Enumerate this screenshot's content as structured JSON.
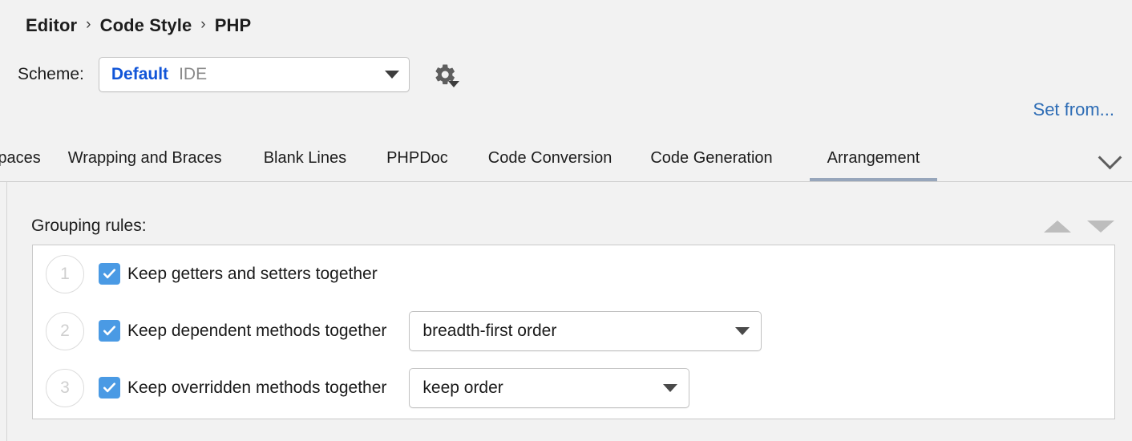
{
  "breadcrumb": {
    "separator": "›",
    "items": [
      "Editor",
      "Code Style",
      "PHP"
    ]
  },
  "scheme": {
    "label": "Scheme:",
    "name": "Default",
    "scope": "IDE",
    "dropdown_icon": "caret-down-icon",
    "gear_icon": "gear-icon"
  },
  "links": {
    "set_from": "Set from..."
  },
  "tabs": {
    "items": [
      {
        "label": "Spaces",
        "active": false
      },
      {
        "label": "Wrapping and Braces",
        "active": false
      },
      {
        "label": "Blank Lines",
        "active": false
      },
      {
        "label": "PHPDoc",
        "active": false
      },
      {
        "label": "Code Conversion",
        "active": false
      },
      {
        "label": "Code Generation",
        "active": false
      },
      {
        "label": "Arrangement",
        "active": true
      }
    ],
    "overflow_icon": "chevron-down-icon"
  },
  "grouping": {
    "title": "Grouping rules:",
    "move_up_icon": "triangle-up-icon",
    "move_down_icon": "triangle-down-icon",
    "rules": [
      {
        "index": "1",
        "label": "Keep getters and setters together",
        "checked": true,
        "combo": null
      },
      {
        "index": "2",
        "label": "Keep dependent methods together",
        "checked": true,
        "combo": "breadth-first order"
      },
      {
        "index": "3",
        "label": "Keep overridden methods together",
        "checked": true,
        "combo": "keep order"
      }
    ]
  },
  "colors": {
    "accent_blue": "#1155d8",
    "link_blue": "#2d6cb5",
    "checkbox_blue": "#4a9ae4",
    "active_tab_underline": "#97a6bb",
    "background": "#f2f2f2",
    "panel_white": "#ffffff"
  }
}
